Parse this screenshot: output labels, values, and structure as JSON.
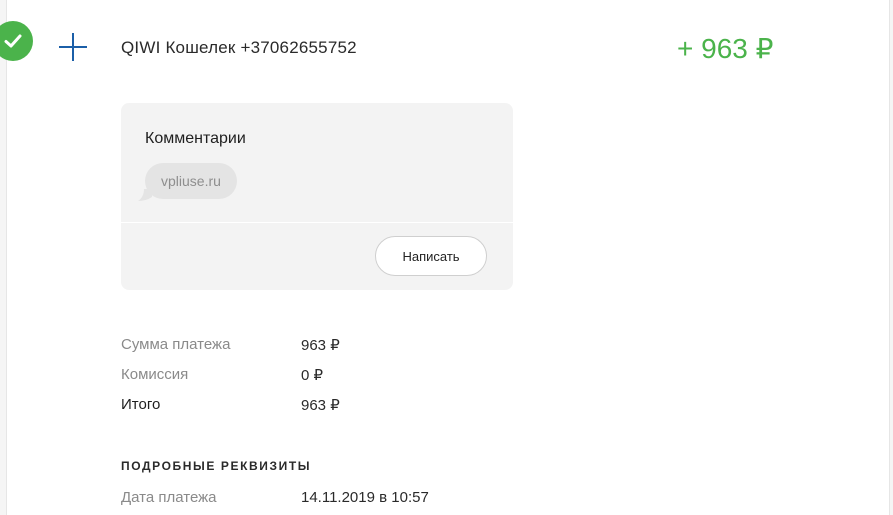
{
  "transaction": {
    "title": "QIWI Кошелек +37062655752",
    "amount": "+ 963 ₽"
  },
  "comments": {
    "title": "Комментарии",
    "items": [
      "vpliuse.ru"
    ],
    "write_button": "Написать"
  },
  "summary": [
    {
      "label": "Сумма платежа",
      "value": "963 ₽"
    },
    {
      "label": "Комиссия",
      "value": "0 ₽"
    },
    {
      "label": "Итого",
      "value": "963 ₽"
    }
  ],
  "details": {
    "heading": "ПОДРОБНЫЕ РЕКВИЗИТЫ",
    "rows": [
      {
        "label": "Дата платежа",
        "value": "14.11.2019 в 10:57"
      }
    ]
  },
  "colors": {
    "success": "#4bb34b",
    "accent": "#1b5fa8"
  },
  "icons": {
    "status": "check-icon",
    "type": "plus-icon"
  }
}
